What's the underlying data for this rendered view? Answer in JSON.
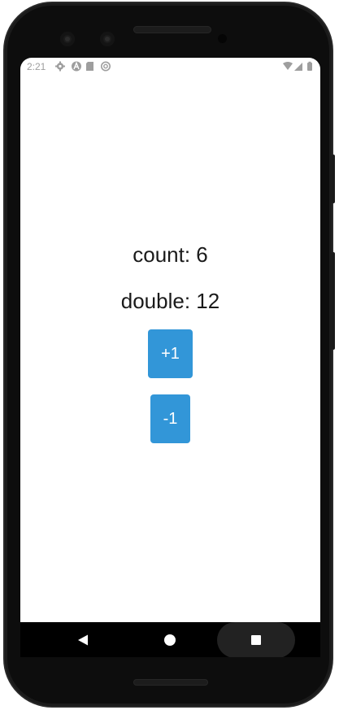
{
  "status_bar": {
    "time": "2:21",
    "left_icons": [
      "settings-icon",
      "a-logo-icon",
      "sd-card-icon",
      "sync-icon"
    ],
    "right_icons": [
      "wifi-icon",
      "cell-signal-icon",
      "battery-icon"
    ]
  },
  "app": {
    "count_text": "count: 6",
    "double_text": "double: 12",
    "increment_label": "+1",
    "decrement_label": "-1",
    "button_color": "#3296d8"
  },
  "nav_bar": {
    "buttons": [
      "back-icon",
      "home-icon",
      "recents-icon"
    ]
  },
  "colors": {
    "screen_background": "#ffffff",
    "text": "#1a1a1a",
    "status_text": "#9e9e9e",
    "nav_background": "#000000",
    "device_frame": "#0d0d0d"
  }
}
